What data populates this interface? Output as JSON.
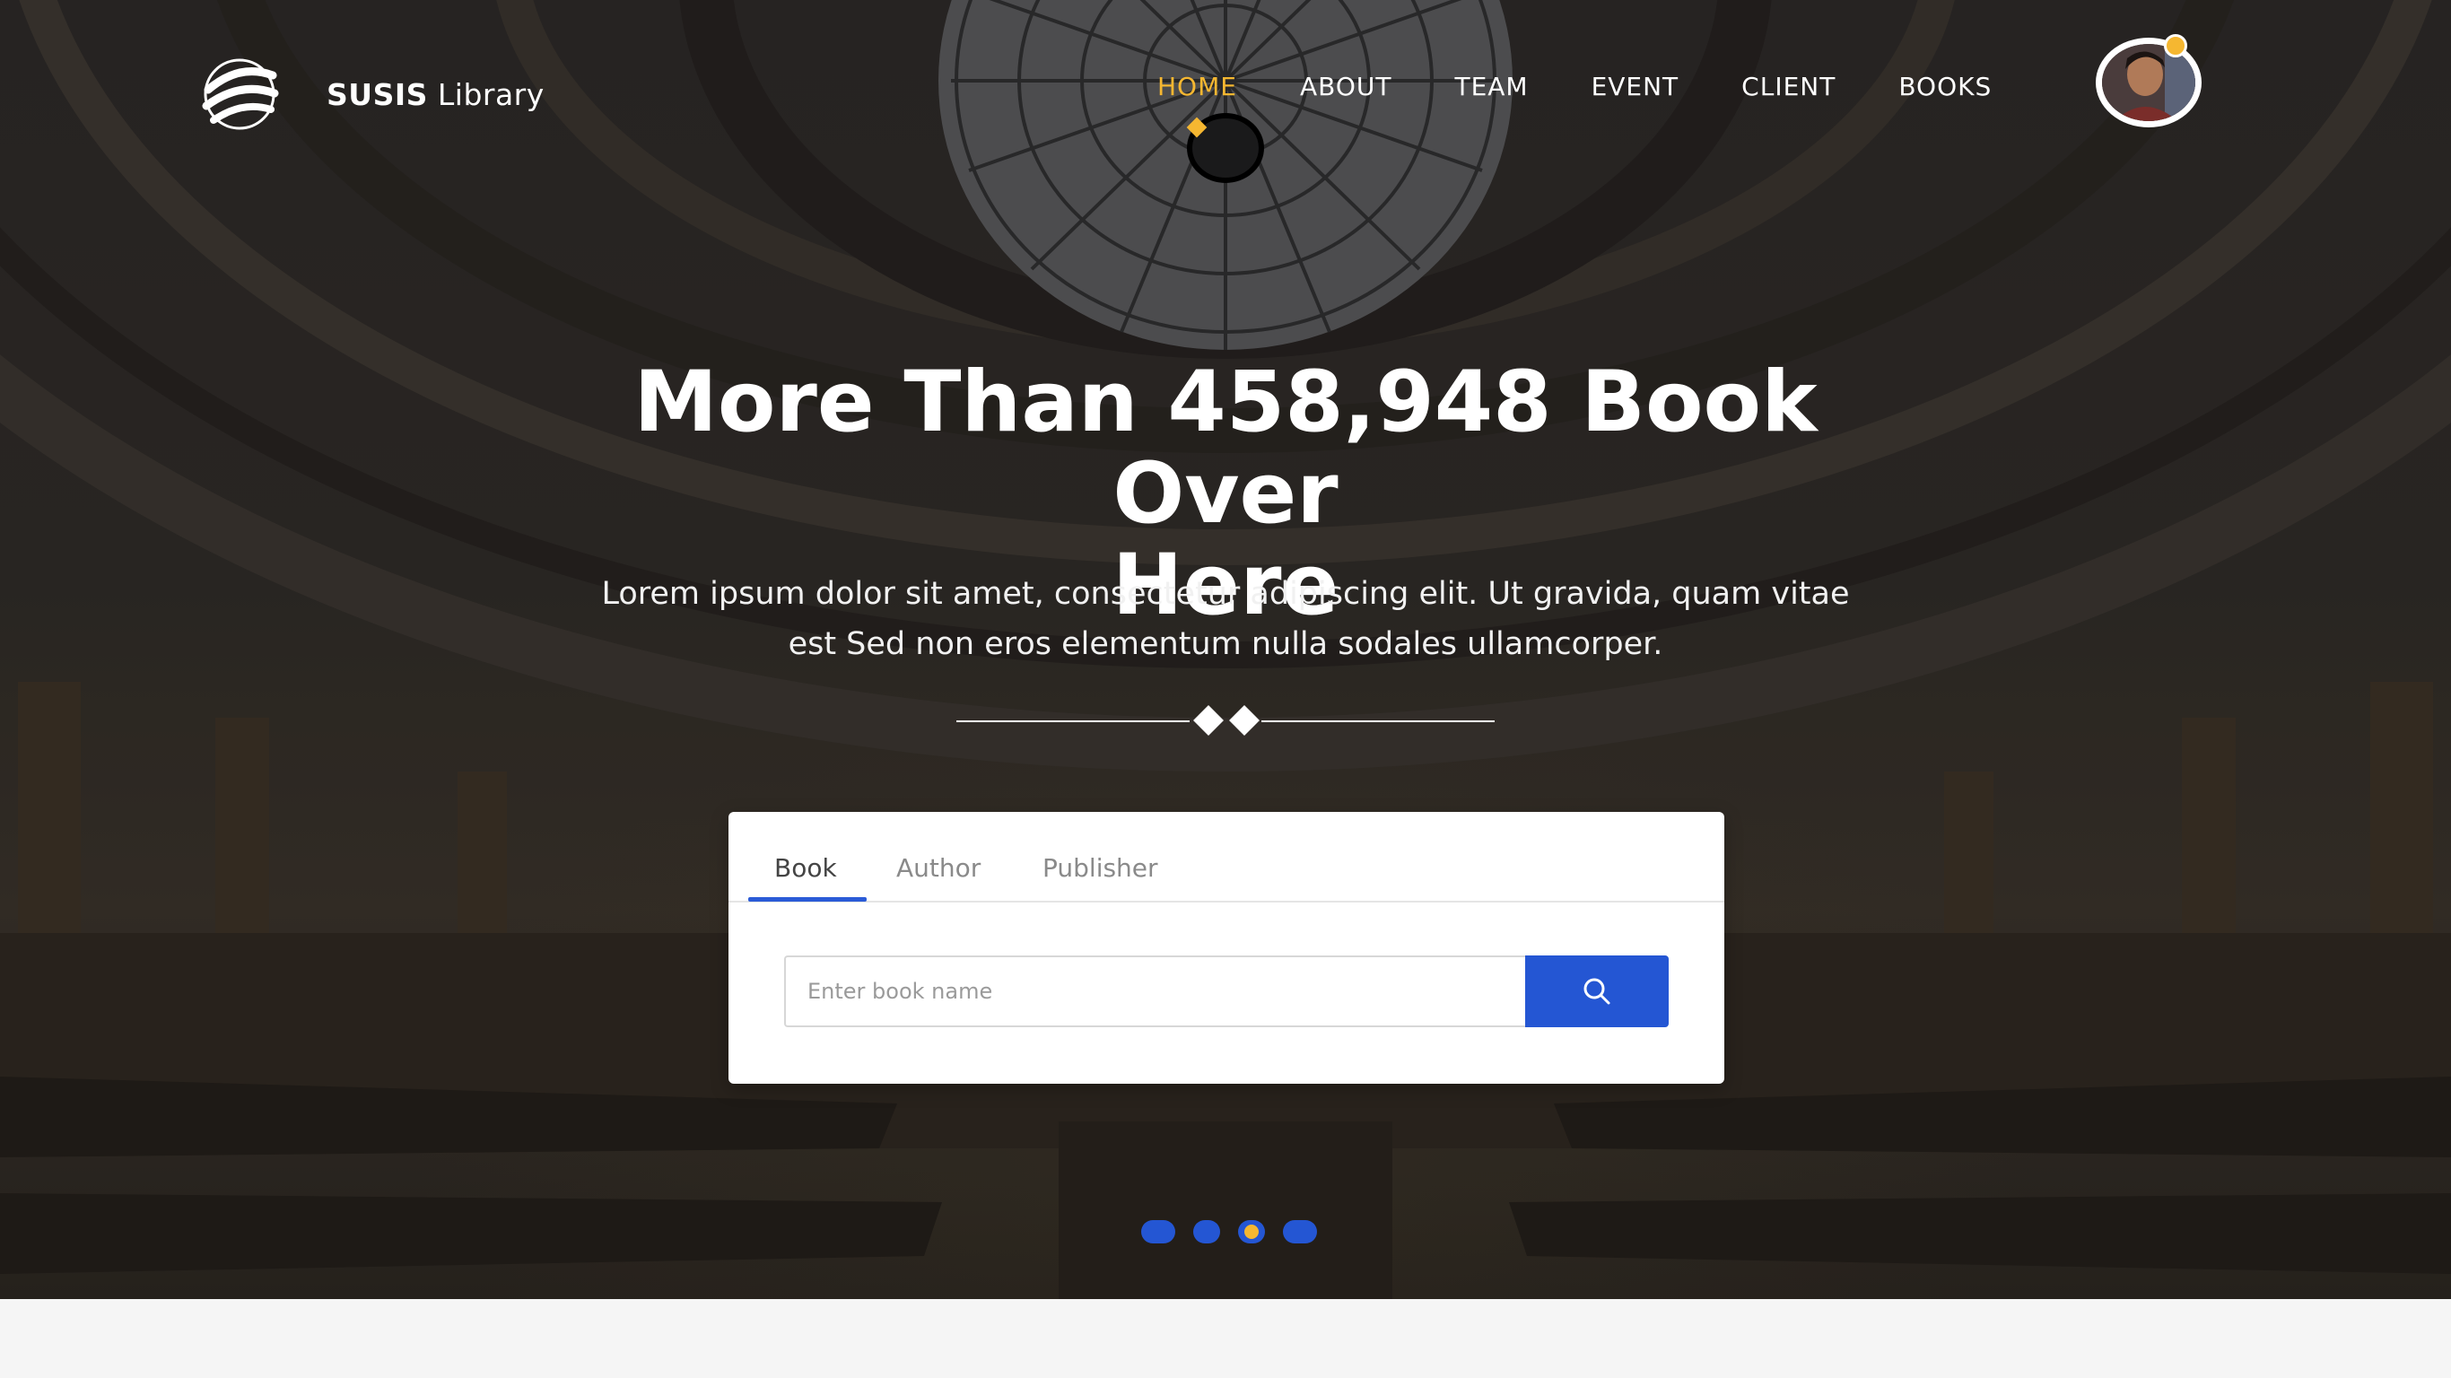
{
  "brand": {
    "bold": "SUSIS",
    "thin": "Library",
    "logo_icon": "globe-swoosh-icon"
  },
  "nav": {
    "items": [
      {
        "label": "HOME",
        "active": true
      },
      {
        "label": "ABOUT"
      },
      {
        "label": "TEAM"
      },
      {
        "label": "EVENT"
      },
      {
        "label": "CLIENT"
      },
      {
        "label": "BOOKS"
      }
    ]
  },
  "hero": {
    "headline_line1": "More Than 458,948 Book Over",
    "headline_line2": "Here",
    "subtext_line1": "Lorem ipsum dolor sit amet, consectetur adipiscing elit. Ut gravida, quam vitae",
    "subtext_line2": "est Sed non eros elementum nulla sodales ullamcorper."
  },
  "search": {
    "tabs": [
      {
        "label": "Book",
        "active": true
      },
      {
        "label": "Author"
      },
      {
        "label": "Publisher"
      }
    ],
    "placeholder": "Enter book name",
    "value": ""
  },
  "carousel": {
    "slide_count": 4,
    "active_index": 2
  },
  "colors": {
    "accent": "#f5b731",
    "primary": "#2456d3"
  }
}
